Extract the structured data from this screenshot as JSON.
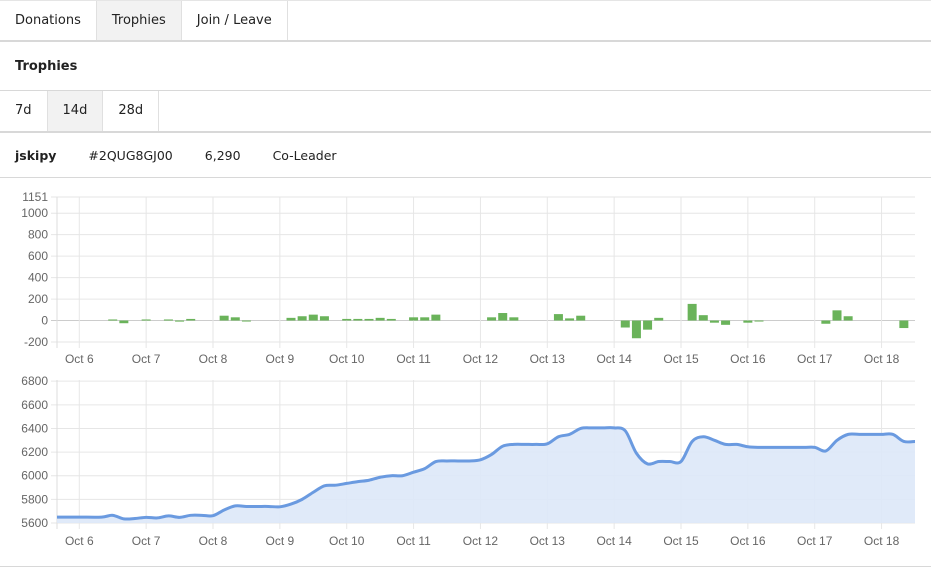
{
  "tabs": [
    {
      "label": "Donations",
      "active": false
    },
    {
      "label": "Trophies",
      "active": true
    },
    {
      "label": "Join / Leave",
      "active": false
    }
  ],
  "section_title": "Trophies",
  "ranges": [
    {
      "label": "7d",
      "active": false
    },
    {
      "label": "14d",
      "active": true
    },
    {
      "label": "28d",
      "active": false
    }
  ],
  "player": {
    "name": "jskipy",
    "tag": "#2QUG8GJ00",
    "trophies": "6,290",
    "role": "Co-Leader"
  },
  "colors": {
    "bar": "#6ab35a",
    "line": "#6a9ae0",
    "area": "#dde8f8",
    "grid": "#e6e6e6"
  },
  "chart_data": [
    {
      "type": "bar",
      "xlim": [
        "10-05 16:00",
        "10-18 12:00"
      ],
      "ylim": [
        -200,
        1151
      ],
      "yticks": [
        "1151",
        "1000",
        "800",
        "600",
        "400",
        "200",
        "0",
        "-200"
      ],
      "xticks": [
        "Oct 6",
        "Oct 7",
        "Oct 8",
        "Oct 9",
        "Oct 10",
        "Oct 11",
        "Oct 12",
        "Oct 13",
        "Oct 14",
        "Oct 15",
        "Oct 16",
        "Oct 17",
        "Oct 18"
      ],
      "grid": true,
      "points": [
        [
          "10-06 12:00",
          10
        ],
        [
          "10-06 16:00",
          -25
        ],
        [
          "10-07 00:00",
          10
        ],
        [
          "10-07 08:00",
          10
        ],
        [
          "10-07 12:00",
          -10
        ],
        [
          "10-07 16:00",
          15
        ],
        [
          "10-08 04:00",
          45
        ],
        [
          "10-08 08:00",
          30
        ],
        [
          "10-08 12:00",
          -5
        ],
        [
          "10-09 04:00",
          25
        ],
        [
          "10-09 08:00",
          40
        ],
        [
          "10-09 12:00",
          55
        ],
        [
          "10-09 16:00",
          40
        ],
        [
          "10-10 00:00",
          15
        ],
        [
          "10-10 04:00",
          15
        ],
        [
          "10-10 08:00",
          15
        ],
        [
          "10-10 12:00",
          25
        ],
        [
          "10-10 16:00",
          15
        ],
        [
          "10-11 00:00",
          30
        ],
        [
          "10-11 04:00",
          30
        ],
        [
          "10-11 08:00",
          55
        ],
        [
          "10-12 04:00",
          30
        ],
        [
          "10-12 08:00",
          70
        ],
        [
          "10-12 12:00",
          30
        ],
        [
          "10-13 04:00",
          60
        ],
        [
          "10-13 08:00",
          20
        ],
        [
          "10-13 12:00",
          45
        ],
        [
          "10-14 04:00",
          -65
        ],
        [
          "10-14 08:00",
          -165
        ],
        [
          "10-14 12:00",
          -85
        ],
        [
          "10-14 16:00",
          25
        ],
        [
          "10-15 04:00",
          155
        ],
        [
          "10-15 08:00",
          50
        ],
        [
          "10-15 12:00",
          -20
        ],
        [
          "10-15 16:00",
          -40
        ],
        [
          "10-16 00:00",
          -20
        ],
        [
          "10-16 04:00",
          -5
        ],
        [
          "10-17 04:00",
          -30
        ],
        [
          "10-17 08:00",
          95
        ],
        [
          "10-17 12:00",
          40
        ],
        [
          "10-18 08:00",
          -70
        ]
      ]
    },
    {
      "type": "area",
      "xlim": [
        "10-05 16:00",
        "10-18 12:00"
      ],
      "ylim": [
        5600,
        6810
      ],
      "yticks": [
        "6800",
        "6600",
        "6400",
        "6200",
        "6000",
        "5800",
        "5600"
      ],
      "xticks": [
        "Oct 6",
        "Oct 7",
        "Oct 8",
        "Oct 9",
        "Oct 10",
        "Oct 11",
        "Oct 12",
        "Oct 13",
        "Oct 14",
        "Oct 15",
        "Oct 16",
        "Oct 17",
        "Oct 18"
      ],
      "grid": true,
      "points": [
        [
          "10-05 16:00",
          5650
        ],
        [
          "10-06 00:00",
          5650
        ],
        [
          "10-06 08:00",
          5650
        ],
        [
          "10-06 12:00",
          5665
        ],
        [
          "10-06 16:00",
          5635
        ],
        [
          "10-06 20:00",
          5638
        ],
        [
          "10-07 00:00",
          5648
        ],
        [
          "10-07 04:00",
          5643
        ],
        [
          "10-07 08:00",
          5660
        ],
        [
          "10-07 12:00",
          5648
        ],
        [
          "10-07 16:00",
          5665
        ],
        [
          "10-07 20:00",
          5665
        ],
        [
          "10-08 00:00",
          5662
        ],
        [
          "10-08 04:00",
          5710
        ],
        [
          "10-08 08:00",
          5745
        ],
        [
          "10-08 12:00",
          5740
        ],
        [
          "10-08 16:00",
          5740
        ],
        [
          "10-08 20:00",
          5740
        ],
        [
          "10-09 00:00",
          5737
        ],
        [
          "10-09 04:00",
          5760
        ],
        [
          "10-09 08:00",
          5800
        ],
        [
          "10-09 12:00",
          5860
        ],
        [
          "10-09 16:00",
          5915
        ],
        [
          "10-09 20:00",
          5920
        ],
        [
          "10-10 00:00",
          5935
        ],
        [
          "10-10 04:00",
          5950
        ],
        [
          "10-10 08:00",
          5962
        ],
        [
          "10-10 12:00",
          5987
        ],
        [
          "10-10 16:00",
          6000
        ],
        [
          "10-10 20:00",
          6000
        ],
        [
          "10-11 00:00",
          6030
        ],
        [
          "10-11 04:00",
          6060
        ],
        [
          "10-11 08:00",
          6120
        ],
        [
          "10-11 12:00",
          6125
        ],
        [
          "10-11 16:00",
          6125
        ],
        [
          "10-11 20:00",
          6125
        ],
        [
          "10-12 00:00",
          6135
        ],
        [
          "10-12 04:00",
          6180
        ],
        [
          "10-12 08:00",
          6250
        ],
        [
          "10-12 12:00",
          6265
        ],
        [
          "10-12 16:00",
          6265
        ],
        [
          "10-12 20:00",
          6265
        ],
        [
          "10-13 00:00",
          6270
        ],
        [
          "10-13 04:00",
          6330
        ],
        [
          "10-13 08:00",
          6350
        ],
        [
          "10-13 12:00",
          6400
        ],
        [
          "10-13 16:00",
          6405
        ],
        [
          "10-13 20:00",
          6405
        ],
        [
          "10-14 00:00",
          6405
        ],
        [
          "10-14 04:00",
          6380
        ],
        [
          "10-14 08:00",
          6190
        ],
        [
          "10-14 12:00",
          6100
        ],
        [
          "10-14 16:00",
          6120
        ],
        [
          "10-14 20:00",
          6120
        ],
        [
          "10-15 00:00",
          6120
        ],
        [
          "10-15 04:00",
          6290
        ],
        [
          "10-15 08:00",
          6330
        ],
        [
          "10-15 12:00",
          6300
        ],
        [
          "10-15 16:00",
          6265
        ],
        [
          "10-15 20:00",
          6265
        ],
        [
          "10-16 00:00",
          6245
        ],
        [
          "10-16 04:00",
          6240
        ],
        [
          "10-16 12:00",
          6240
        ],
        [
          "10-16 20:00",
          6240
        ],
        [
          "10-17 00:00",
          6240
        ],
        [
          "10-17 04:00",
          6210
        ],
        [
          "10-17 08:00",
          6300
        ],
        [
          "10-17 12:00",
          6350
        ],
        [
          "10-17 16:00",
          6350
        ],
        [
          "10-17 20:00",
          6350
        ],
        [
          "10-18 00:00",
          6350
        ],
        [
          "10-18 04:00",
          6350
        ],
        [
          "10-18 08:00",
          6290
        ],
        [
          "10-18 12:00",
          6290
        ]
      ]
    }
  ]
}
